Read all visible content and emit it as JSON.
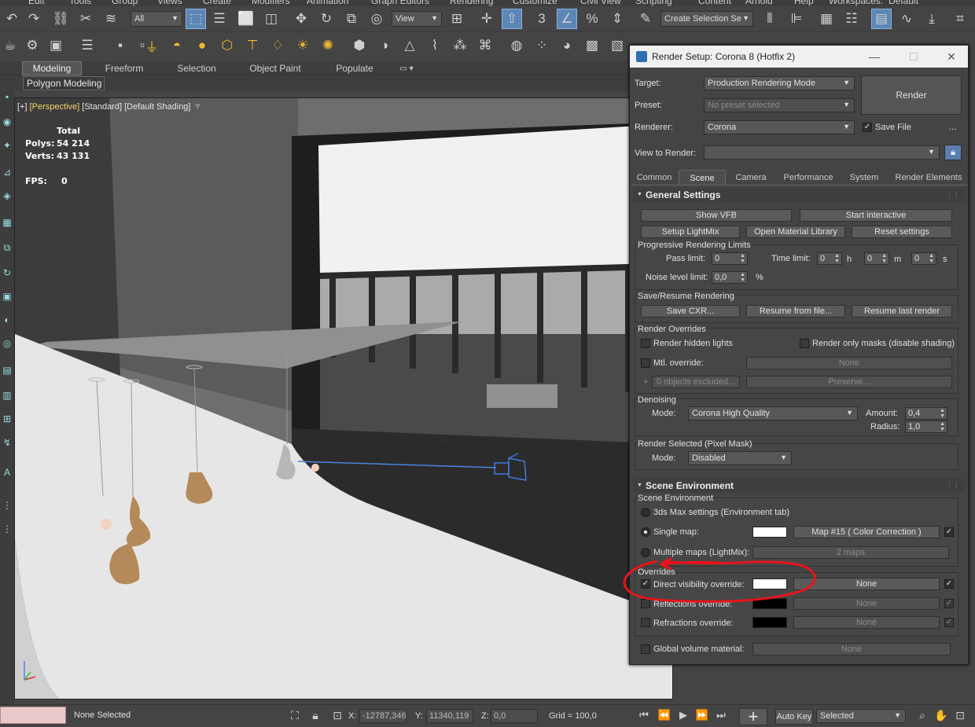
{
  "menubar": [
    "Edit",
    "Tools",
    "Group",
    "Views",
    "Create",
    "Modifiers",
    "Animation",
    "Graph Editors",
    "Rendering",
    "Customize",
    "Civil View",
    "Scripting",
    "Content",
    "Arnold",
    "Help"
  ],
  "toolbar": {
    "filter_dropdown": "All",
    "view_dropdown": "View",
    "selection_set_placeholder": "Create Selection Se",
    "workspace_label": "Workspaces:",
    "workspace_value": "Default"
  },
  "ribbon_tabs": [
    "Modeling",
    "Freeform",
    "Selection",
    "Object Paint",
    "Populate"
  ],
  "ribbon_active": "Modeling",
  "ribbon_sub": "Polygon Modeling",
  "viewport": {
    "label_plus": "[+]",
    "label_view": "[Perspective]",
    "label_std": "[Standard]",
    "label_shading": "[Default Shading]",
    "total_label": "Total",
    "polys_label": "Polys:",
    "polys_value": "54 214",
    "verts_label": "Verts:",
    "verts_value": "43 131",
    "fps_label": "FPS:",
    "fps_value": "0"
  },
  "statusbar": {
    "selection": "None Selected",
    "x_label": "X:",
    "x_value": "-12787,346",
    "y_label": "Y:",
    "y_value": "11340,119",
    "z_label": "Z:",
    "z_value": "0,0",
    "grid": "Grid = 100,0",
    "autokey": "Auto Key",
    "selected": "Selected"
  },
  "dialog": {
    "title": "Render Setup: Corona 8 (Hotfix 2)",
    "target_label": "Target:",
    "target_value": "Production Rendering Mode",
    "preset_label": "Preset:",
    "preset_value": "No preset selected",
    "renderer_label": "Renderer:",
    "renderer_value": "Corona",
    "save_file": "Save File",
    "more": "...",
    "view_to_render_label": "View to Render:",
    "render_button": "Render",
    "tabs": [
      "Common",
      "Scene",
      "Camera",
      "Performance",
      "System",
      "Render Elements"
    ],
    "active_tab": "Scene",
    "general": {
      "title": "General Settings",
      "show_vfb": "Show VFB",
      "start_interactive": "Start interactive",
      "setup_lightmix": "Setup LightMix",
      "open_material_library": "Open Material Library",
      "reset_settings": "Reset settings",
      "prog_title": "Progressive Rendering Limits",
      "pass_limit_label": "Pass limit:",
      "pass_limit": "0",
      "time_limit_label": "Time limit:",
      "time_h": "0",
      "h": "h",
      "time_m": "0",
      "m": "m",
      "time_s": "0",
      "s": "s",
      "noise_label": "Noise level limit:",
      "noise_value": "0,0",
      "percent": "%",
      "save_title": "Save/Resume Rendering",
      "save_cxr": "Save CXR...",
      "resume_file": "Resume from file...",
      "resume_last": "Resume last render",
      "overrides_title": "Render Overrides",
      "hidden_lights": "Render hidden lights",
      "only_masks": "Render only masks (disable shading)",
      "mtl_override": "Mtl. override:",
      "mtl_none": "None",
      "excluded": "0 objects excluded...",
      "preserve": "Preserve...",
      "denoise_title": "Denoising",
      "mode_label": "Mode:",
      "denoise_mode": "Corona High Quality",
      "amount_label": "Amount:",
      "amount_value": "0,4",
      "radius_label": "Radius:",
      "radius_value": "1,0",
      "rsel_title": "Render Selected (Pixel Mask)",
      "rsel_mode_label": "Mode:",
      "rsel_mode": "Disabled"
    },
    "scene_env": {
      "title": "Scene Environment",
      "group_title": "Scene Environment",
      "max_settings": "3ds Max settings (Environment tab)",
      "single_map": "Single map:",
      "map_name": "Map #15  ( Color Correction )",
      "multiple_maps": "Multiple maps (LightMix):",
      "two_maps": "2 maps",
      "overrides_title": "Overrides",
      "direct_vis": "Direct visibility override:",
      "direct_none": "None",
      "reflections": "Reflections override:",
      "reflections_none": "None",
      "refractions": "Refractions override:",
      "refractions_none": "None",
      "global_volume": "Global volume material:",
      "global_none": "None"
    }
  },
  "colors": {
    "annotation": "#e8141b",
    "selection_blue": "#5c86b5"
  }
}
